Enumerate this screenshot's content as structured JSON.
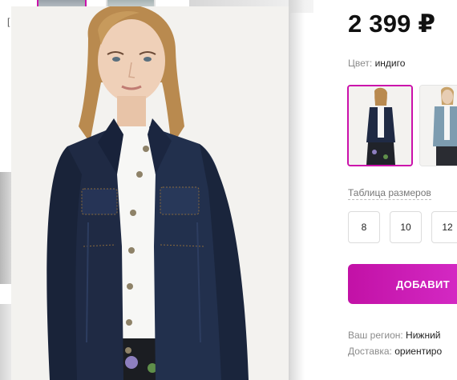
{
  "product": {
    "price": "2 399 ₽",
    "color_label": "Цвет:",
    "color_value": "индиго"
  },
  "sizes": {
    "table_link": "Таблица размеров",
    "options": [
      "8",
      "10",
      "12"
    ]
  },
  "cart": {
    "add_button": "ДОБАВИТ"
  },
  "delivery": {
    "region_label": "Ваш регион:",
    "region_value": "Нижний",
    "delivery_label": "Доставка:",
    "delivery_value": "ориентиро"
  },
  "colors": {
    "accent": "#cb11ab",
    "denim": "#1f2a44",
    "text_muted": "#8b8b8b"
  }
}
